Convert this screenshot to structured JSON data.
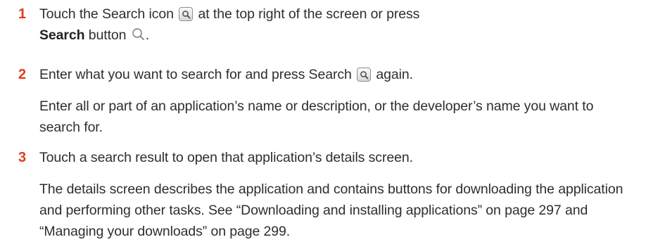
{
  "steps": [
    {
      "number": "1",
      "line1_before_icon": "Touch the Search icon",
      "line1_after_icon": "at the top right of the screen or press",
      "line2_bold": "Search",
      "line2_rest": "button",
      "line2_end": "."
    },
    {
      "number": "2",
      "line1_before_icon": "Enter what you want to search for and press Search",
      "line1_after_icon": "again.",
      "paragraph": "Enter all or part of an application’s name or description, or the developer’s name you want to search for."
    },
    {
      "number": "3",
      "line1": "Touch a search result to open that application’s details screen.",
      "paragraph": "The details screen describes the application and contains buttons for downloading the application and performing other tasks. See “Downloading and installing applications” on page 297 and “Managing your downloads” on page 299."
    }
  ],
  "icons": {
    "search_icon_button": "search-icon",
    "search_hardware_button": "magnifier-icon"
  },
  "colors": {
    "step_number": "#e23b1a",
    "body_text": "#2e2e2e"
  }
}
